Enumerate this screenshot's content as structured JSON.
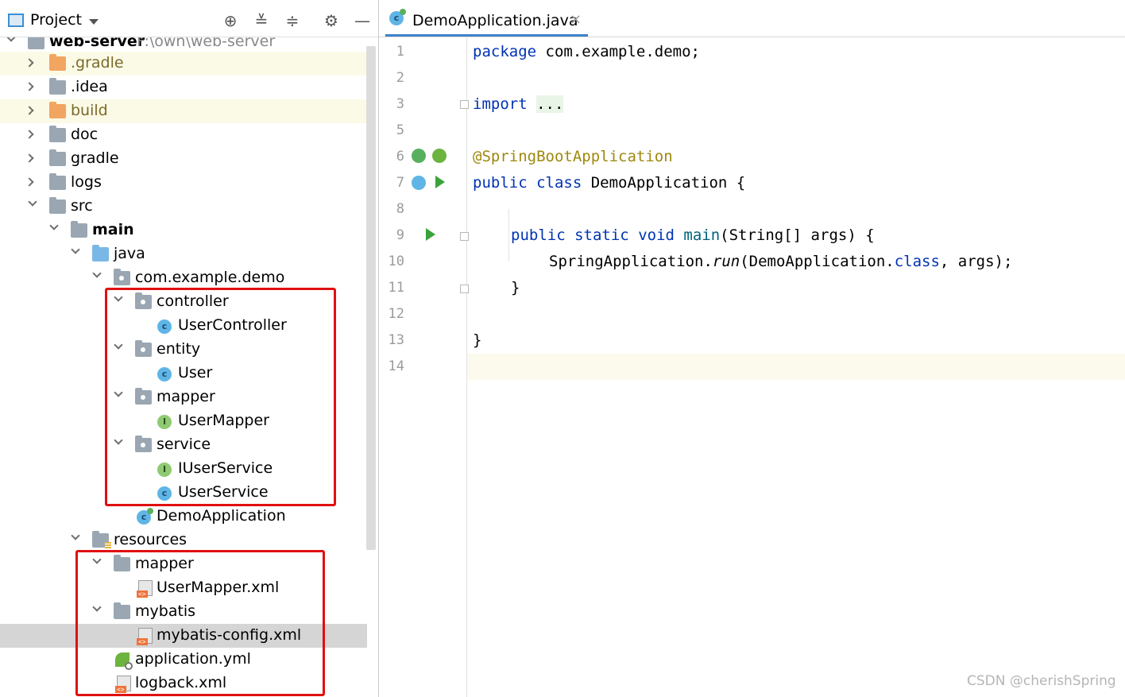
{
  "project_panel": {
    "title": "Project",
    "toolbar": [
      "locate-icon",
      "expand-all-icon",
      "collapse-all-icon",
      "gear-icon",
      "minimize-icon"
    ],
    "root": {
      "name": "web-server",
      "path": "F:\\own\\web-server"
    },
    "tree": [
      {
        "label": ".gradle",
        "icon": "folder-orange-icon"
      },
      {
        "label": ".idea",
        "icon": "folder-icon"
      },
      {
        "label": "build",
        "icon": "folder-orange-icon"
      },
      {
        "label": "doc",
        "icon": "folder-icon"
      },
      {
        "label": "gradle",
        "icon": "folder-icon"
      },
      {
        "label": "logs",
        "icon": "folder-icon"
      },
      {
        "label": "src",
        "icon": "folder-icon"
      },
      {
        "label": "main",
        "icon": "module-folder-icon"
      },
      {
        "label": "java",
        "icon": "source-folder-icon"
      },
      {
        "label": "com.example.demo",
        "icon": "package-icon"
      },
      {
        "label": "controller",
        "icon": "package-icon"
      },
      {
        "label": "UserController",
        "icon": "class-icon"
      },
      {
        "label": "entity",
        "icon": "package-icon"
      },
      {
        "label": "User",
        "icon": "class-icon"
      },
      {
        "label": "mapper",
        "icon": "package-icon"
      },
      {
        "label": "UserMapper",
        "icon": "interface-icon"
      },
      {
        "label": "service",
        "icon": "package-icon"
      },
      {
        "label": "IUserService",
        "icon": "interface-icon"
      },
      {
        "label": "UserService",
        "icon": "class-icon"
      },
      {
        "label": "DemoApplication",
        "icon": "spring-boot-class-icon"
      },
      {
        "label": "resources",
        "icon": "resources-folder-icon"
      },
      {
        "label": "mapper",
        "icon": "folder-icon"
      },
      {
        "label": "UserMapper.xml",
        "icon": "xml-file-icon"
      },
      {
        "label": "mybatis",
        "icon": "folder-icon"
      },
      {
        "label": "mybatis-config.xml",
        "icon": "xml-file-icon",
        "selected": true
      },
      {
        "label": "application.yml",
        "icon": "spring-yml-icon"
      },
      {
        "label": "logback.xml",
        "icon": "xml-file-icon"
      }
    ]
  },
  "editor": {
    "tab": {
      "label": "DemoApplication.java",
      "close": "×"
    },
    "line_numbers": [
      "1",
      "2",
      "3",
      "5",
      "6",
      "7",
      "8",
      "9",
      "10",
      "11",
      "12",
      "13",
      "14"
    ],
    "code": {
      "l1_kw": "package",
      "l1_rest": " com.example.demo;",
      "l3_kw": "import",
      "l3_fold": "...",
      "l6_ann": "@SpringBootApplication",
      "l7_kw1": "public",
      "l7_kw2": "class",
      "l7_rest": " DemoApplication {",
      "l9_kw1": "public",
      "l9_kw2": "static",
      "l9_kw3": "void",
      "l9_fn": "main",
      "l9_rest": "(String[] args) {",
      "l10_a": "SpringApplication.",
      "l10_run": "run",
      "l10_b": "(DemoApplication.",
      "l10_class": "class",
      "l10_c": ", args);",
      "l11": "}",
      "l13": "}"
    }
  },
  "watermark": "CSDN @cherishSpring",
  "colors": {
    "keyword": "#0033b3",
    "annotation": "#9e880d",
    "method": "#00627a",
    "highlight_box": "#e01010",
    "tab_underline": "#4083c9"
  }
}
